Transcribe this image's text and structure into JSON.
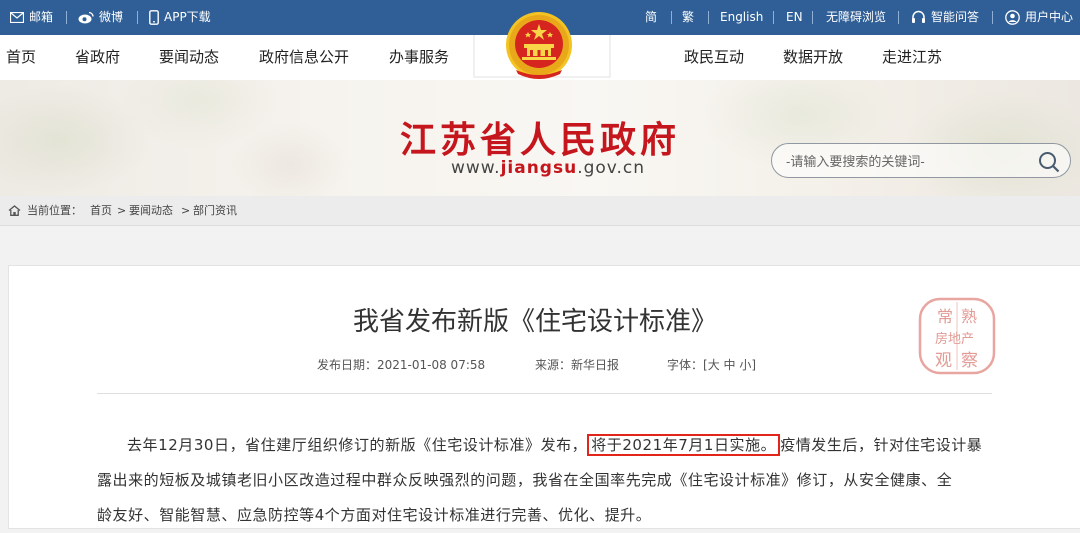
{
  "topbar": {
    "mail": "邮箱",
    "weibo": "微博",
    "app": "APP下载",
    "simplified": "简",
    "traditional": "繁",
    "english": "English",
    "en": "EN",
    "accessible": "无障碍浏览",
    "qa": "智能问答",
    "user": "用户中心"
  },
  "nav": {
    "left": [
      "首页",
      "省政府",
      "要闻动态",
      "政府信息公开",
      "办事服务"
    ],
    "right": [
      "政民互动",
      "数据开放",
      "走进江苏"
    ]
  },
  "banner": {
    "title": "江苏省人民政府",
    "url_prefix": "www.",
    "url_highlight": "jiangsu",
    "url_suffix": ".gov.cn",
    "search_placeholder": "-请输入要搜索的关键词-"
  },
  "breadcrumb": {
    "label": "当前位置：",
    "items": [
      "首页",
      "要闻动态",
      "部门资讯"
    ],
    "sep": ">"
  },
  "article": {
    "title": "我省发布新版《住宅设计标准》",
    "date": "发布日期：2021-01-08 07:58",
    "source": "来源：新华日报",
    "font_label": "字体：",
    "font_sizes": [
      "[大",
      "中",
      "小]"
    ],
    "line1_a": "去年12月30日，省住建厅组织修订的新版《住宅设计标准》发布，",
    "line1_hl": "将于2021年7月1日实施。",
    "line1_b": "疫情发生后，针对住宅设计暴",
    "line2": "露出来的短板及城镇老旧小区改造过程中群众反映强烈的问题，我省在全国率先完成《住宅设计标准》修订，从安全健康、全",
    "line3": "龄友好、智能智慧、应急防控等4个方面对住宅设计标准进行完善、优化、提升。"
  },
  "stamp": {
    "chars": [
      "常",
      "熟",
      "房地产",
      "观",
      "察"
    ]
  },
  "colors": {
    "topbar": "#2f5f96",
    "brand_red": "#c4161c",
    "highlight_box": "#e3241b"
  }
}
